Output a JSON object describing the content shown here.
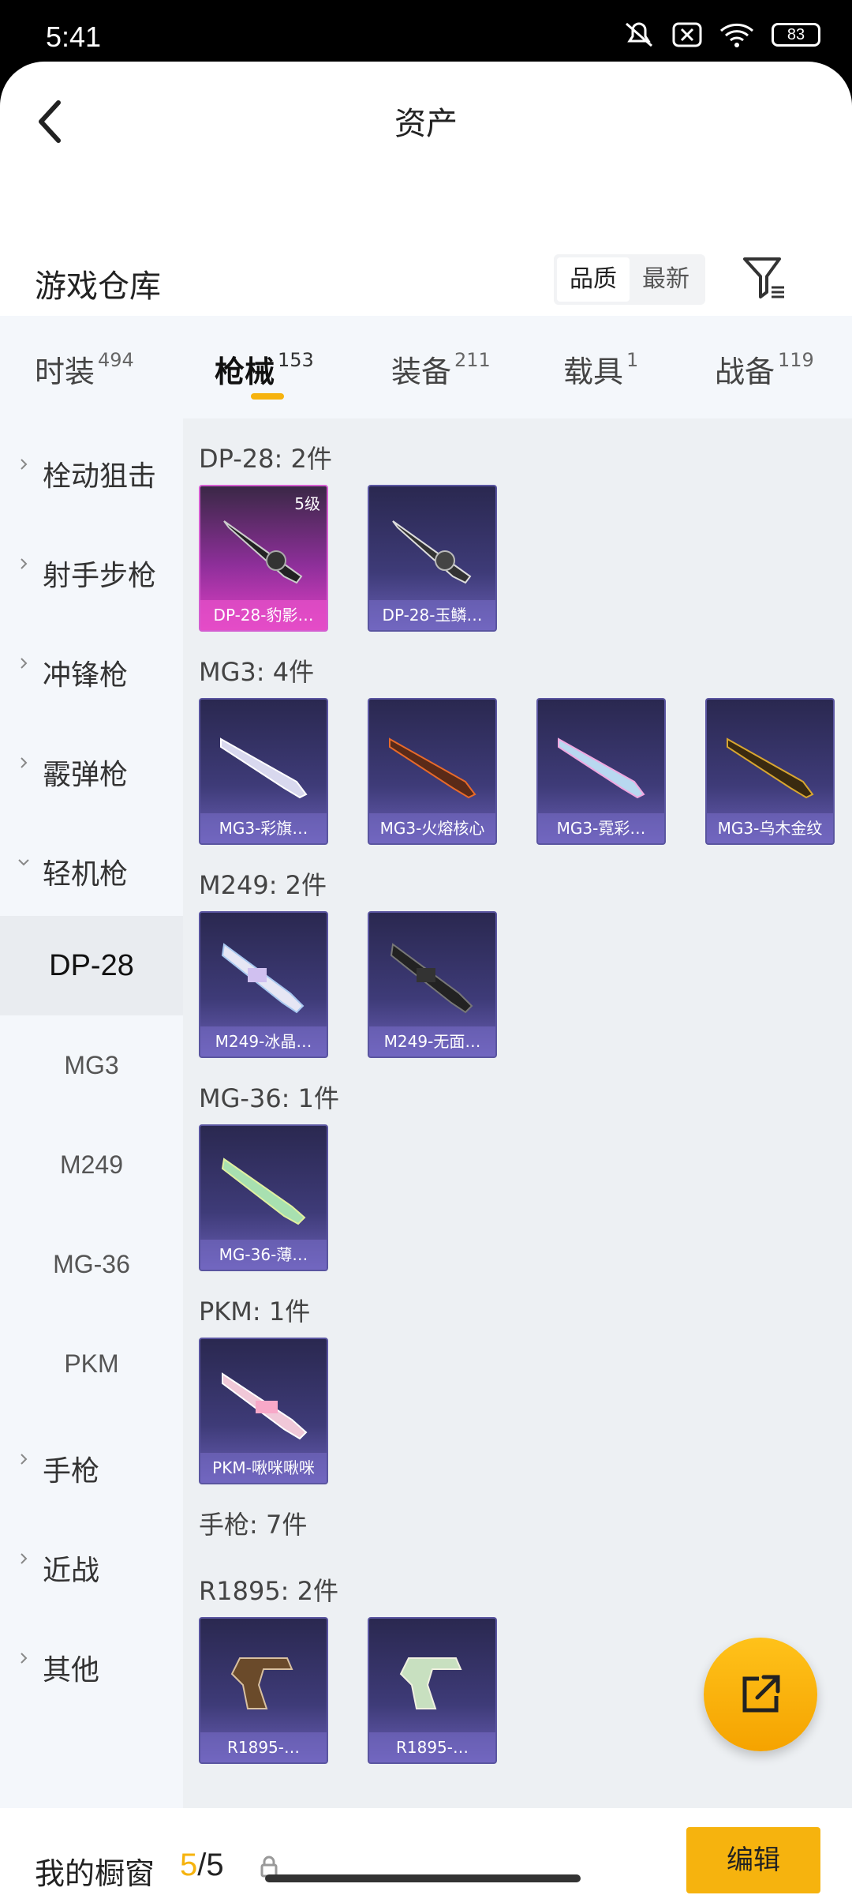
{
  "status_bar": {
    "time": "5:41",
    "battery": "83"
  },
  "header": {
    "title": "资产"
  },
  "warehouse": {
    "title": "游戏仓库",
    "sort_options": [
      "品质",
      "最新"
    ],
    "sort_selected": "品质"
  },
  "tabs": [
    {
      "label": "时装",
      "count": "494"
    },
    {
      "label": "枪械",
      "count": "153",
      "active": true
    },
    {
      "label": "装备",
      "count": "211"
    },
    {
      "label": "载具",
      "count": "1"
    },
    {
      "label": "战备",
      "count": "119"
    }
  ],
  "sidebar": {
    "categories": [
      "栓动狙击",
      "射手步枪",
      "冲锋枪",
      "霰弹枪",
      "轻机枪"
    ],
    "subcategories": [
      "DP-28",
      "MG3",
      "M249",
      "MG-36",
      "PKM"
    ],
    "active_sub": "DP-28",
    "more_categories": [
      "手枪",
      "近战",
      "其他"
    ]
  },
  "groups": [
    {
      "title": "DP-28: 2件",
      "items": [
        {
          "name": "DP-28-豹影…",
          "level": "5级",
          "tier": "gold"
        },
        {
          "name": "DP-28-玉鳞…",
          "tier": "purple"
        }
      ]
    },
    {
      "title": "MG3: 4件",
      "items": [
        {
          "name": "MG3-彩旗…",
          "tier": "purple"
        },
        {
          "name": "MG3-火熔核心",
          "tier": "purple"
        },
        {
          "name": "MG3-霓彩…",
          "tier": "purple"
        },
        {
          "name": "MG3-乌木金纹",
          "tier": "purple"
        }
      ]
    },
    {
      "title": "M249: 2件",
      "items": [
        {
          "name": "M249-冰晶…",
          "tier": "purple"
        },
        {
          "name": "M249-无面…",
          "tier": "purple"
        }
      ]
    },
    {
      "title": "MG-36: 1件",
      "items": [
        {
          "name": "MG-36-薄…",
          "tier": "purple"
        }
      ]
    },
    {
      "title": "PKM: 1件",
      "items": [
        {
          "name": "PKM-啾咪啾咪",
          "tier": "purple"
        }
      ]
    }
  ],
  "pistol_section": {
    "title": "手枪: 7件"
  },
  "r1895_group": {
    "title": "R1895: 2件",
    "items": [
      {
        "name": "R1895-…",
        "tier": "purple"
      },
      {
        "name": "R1895-…",
        "tier": "purple"
      }
    ]
  },
  "bottom_bar": {
    "label": "我的橱窗",
    "count_current": "5",
    "count_total": "/5",
    "edit_label": "编辑"
  },
  "colors": {
    "accent": "#f6b30e",
    "card_purple": "#3e3b78",
    "card_gold": "#e040c4"
  }
}
